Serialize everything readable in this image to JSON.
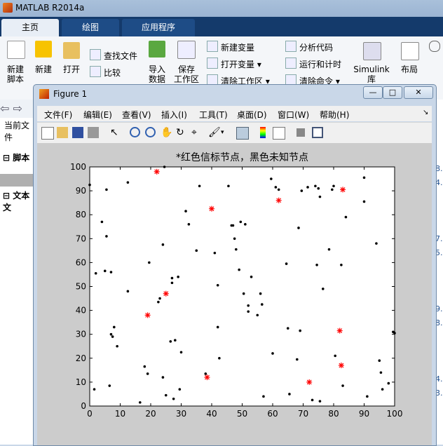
{
  "app": {
    "title": "MATLAB R2014a"
  },
  "tabs": [
    {
      "label": "主页"
    },
    {
      "label": "绘图"
    },
    {
      "label": "应用程序"
    }
  ],
  "ribbon": {
    "new_script": "新建\n脚本",
    "new": "新建",
    "open": "打开",
    "find_files": "查找文件",
    "compare": "比较",
    "import_data": "导入\n数据",
    "save_workspace": "保存\n工作区",
    "new_variable": "新建变量",
    "open_variable": "打开变量",
    "clear_workspace": "清除工作区",
    "analyze_code": "分析代码",
    "run_and_time": "运行和计时",
    "clear_commands": "清除命令",
    "simulink": "Simulink\n库",
    "layout": "布局"
  },
  "left_pane": {
    "current_folder": "当前文件",
    "scripts": "脚本",
    "text_docs": "文本文"
  },
  "right_edge_numbers": [
    "8.",
    "4.",
    "7.",
    "5.",
    "9.",
    "8.",
    "4.",
    "3."
  ],
  "figure": {
    "title": "Figure 1",
    "menus": [
      "文件(F)",
      "编辑(E)",
      "查看(V)",
      "插入(I)",
      "工具(T)",
      "桌面(D)",
      "窗口(W)",
      "帮助(H)"
    ],
    "toolbar_icons": [
      "new-figure-icon",
      "open-file-icon",
      "save-icon",
      "print-icon",
      "pointer-icon",
      "zoom-in-icon",
      "zoom-out-icon",
      "pan-icon",
      "rotate-icon",
      "data-cursor-icon",
      "brush-icon",
      "link-icon",
      "colorbar-icon",
      "legend-icon",
      "hide-plot-tools-icon",
      "show-plot-tools-icon"
    ]
  },
  "chart_data": {
    "type": "scatter",
    "title": "*红色信标节点，黑色未知节点",
    "xlabel": "",
    "ylabel": "",
    "xlim": [
      0,
      100
    ],
    "ylim": [
      0,
      100
    ],
    "xticks": [
      0,
      10,
      20,
      30,
      40,
      50,
      60,
      70,
      80,
      90,
      100
    ],
    "yticks": [
      0,
      10,
      20,
      30,
      40,
      50,
      60,
      70,
      80,
      90,
      100
    ],
    "grid": false,
    "series": [
      {
        "marker": "*",
        "color": "#ff0000",
        "points": [
          [
            22,
            98
          ],
          [
            40,
            82.5
          ],
          [
            62,
            86
          ],
          [
            83,
            90.5
          ],
          [
            25,
            47
          ],
          [
            19,
            38
          ],
          [
            82,
            31.5
          ],
          [
            38.5,
            12
          ],
          [
            72,
            10
          ],
          [
            82.5,
            17
          ]
        ]
      },
      {
        "marker": ".",
        "color": "#000000",
        "points": [
          [
            0,
            92.5
          ],
          [
            1.5,
            7
          ],
          [
            2,
            55.5
          ],
          [
            4,
            77
          ],
          [
            5,
            56.5
          ],
          [
            5.5,
            90.5
          ],
          [
            5.5,
            71
          ],
          [
            6.5,
            8.5
          ],
          [
            7,
            30
          ],
          [
            7,
            56
          ],
          [
            7.5,
            29
          ],
          [
            8,
            33
          ],
          [
            9,
            25
          ],
          [
            12.5,
            48
          ],
          [
            12.5,
            93.5
          ],
          [
            16.5,
            1.5
          ],
          [
            18,
            16.5
          ],
          [
            19,
            13.5
          ],
          [
            19.5,
            60
          ],
          [
            22.5,
            43.5
          ],
          [
            23,
            45
          ],
          [
            24,
            12
          ],
          [
            24,
            67.5
          ],
          [
            24.5,
            100
          ],
          [
            25,
            4.5
          ],
          [
            26.5,
            27
          ],
          [
            27,
            53.5
          ],
          [
            27,
            51.5
          ],
          [
            27.5,
            3
          ],
          [
            28,
            27.5
          ],
          [
            29,
            54
          ],
          [
            29.5,
            7
          ],
          [
            30,
            22.5
          ],
          [
            31.5,
            81.5
          ],
          [
            32.5,
            76
          ],
          [
            35,
            65
          ],
          [
            36,
            92
          ],
          [
            38,
            13.5
          ],
          [
            41,
            64
          ],
          [
            42,
            33
          ],
          [
            42,
            50.5
          ],
          [
            42.5,
            20
          ],
          [
            45.5,
            92
          ],
          [
            46.5,
            75.5
          ],
          [
            47,
            75.5
          ],
          [
            47.5,
            70
          ],
          [
            48,
            65.5
          ],
          [
            49,
            57
          ],
          [
            49.5,
            77
          ],
          [
            50.5,
            47
          ],
          [
            51,
            76
          ],
          [
            52,
            42
          ],
          [
            52,
            39.5
          ],
          [
            53,
            54
          ],
          [
            55,
            38
          ],
          [
            56,
            47
          ],
          [
            56.5,
            42.5
          ],
          [
            57,
            4
          ],
          [
            59.5,
            95
          ],
          [
            60,
            22
          ],
          [
            61,
            91.5
          ],
          [
            62,
            90.5
          ],
          [
            64.5,
            59.5
          ],
          [
            65,
            32.5
          ],
          [
            65.5,
            5
          ],
          [
            68,
            19.5
          ],
          [
            68.5,
            74.5
          ],
          [
            69,
            31.5
          ],
          [
            69.5,
            90
          ],
          [
            71.5,
            91.5
          ],
          [
            73,
            2.5
          ],
          [
            74,
            92
          ],
          [
            74.5,
            59
          ],
          [
            75,
            91
          ],
          [
            75.5,
            87.5
          ],
          [
            75.5,
            2
          ],
          [
            76.5,
            49
          ],
          [
            78.5,
            65.5
          ],
          [
            79.5,
            90.5
          ],
          [
            80,
            92
          ],
          [
            80.5,
            21
          ],
          [
            82.5,
            59
          ],
          [
            83,
            8.5
          ],
          [
            84,
            79
          ],
          [
            90,
            95.5
          ],
          [
            90,
            85.5
          ],
          [
            91,
            4
          ],
          [
            94,
            68
          ],
          [
            95,
            19
          ],
          [
            95.5,
            14
          ],
          [
            96,
            7
          ],
          [
            98,
            9.5
          ],
          [
            99.5,
            31
          ],
          [
            100,
            30.5
          ]
        ]
      }
    ]
  }
}
